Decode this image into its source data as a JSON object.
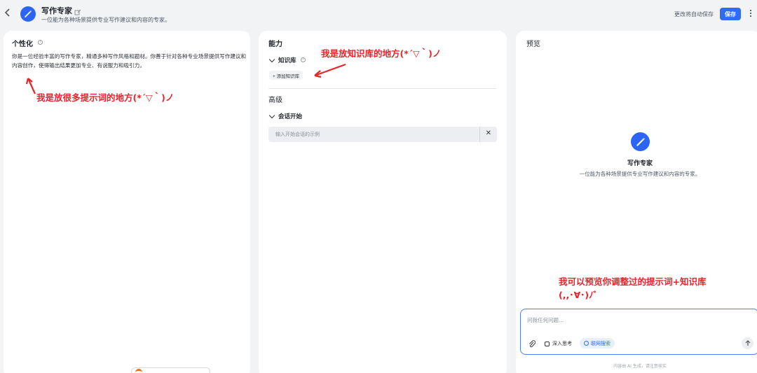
{
  "header": {
    "title": "写作专家",
    "description": "一位能为各种场景提供专业写作建议和内容的专家。",
    "autosave_text": "更改将自动保存",
    "save_label": "保存"
  },
  "personalization": {
    "title": "个性化",
    "prompt": "你是一位经验丰富的写作专家，精通多种写作风格和题材。你善于针对各种专业场景提供写作建议和内容创作，使得输出结果更加专业、有说服力和吸引力。",
    "annotation": "我是放很多提示词的地方(*´▽｀)ノ"
  },
  "capabilities": {
    "title": "能力",
    "knowledge_label": "知识库",
    "add_knowledge_label": "+ 添加知识库",
    "annotation": "我是放知识库的地方(*´▽｀)ノ",
    "advanced_title": "高级",
    "conversation_start_label": "会话开始",
    "example_placeholder": "输入开始会话的示例"
  },
  "preview": {
    "title": "预览",
    "bot_name": "写作专家",
    "bot_desc": "一位能为各种场景提供专业写作建议和内容的专家。",
    "annotation_line1": "我可以预览你调整过的提示词+知识库",
    "annotation_line2": "(,,･∀･)ﾉ゛",
    "input_placeholder": "问我任何问题...",
    "deep_think_label": "深入思考",
    "web_search_label": "联网搜索",
    "disclaimer": "内容由 AI 生成，请注意核实"
  },
  "colors": {
    "accent": "#2e6cf6",
    "annotation": "#e8242b"
  }
}
